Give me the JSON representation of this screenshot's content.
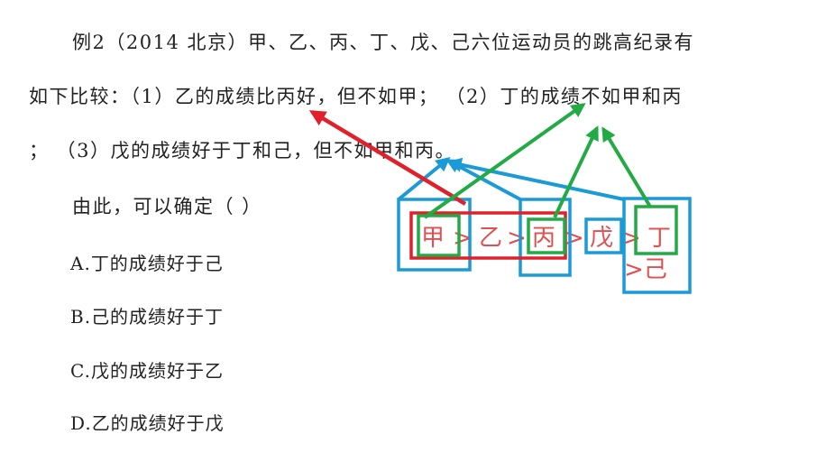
{
  "question": {
    "line1": "例2（2014 北京）甲、乙、丙、丁、戊、己六位运动员的跳高纪录有",
    "line2": "如下比较：（1）乙的成绩比丙好，但不如甲；  （2）丁的成绩不如甲和丙",
    "line3": "；  （3）戊的成绩好于丁和己，但不如甲和丙。",
    "prompt": "由此，可以确定（     ）"
  },
  "options": [
    {
      "label": "A.",
      "text": "丁的成绩好于己"
    },
    {
      "label": "B.",
      "text": "己的成绩好于丁"
    },
    {
      "label": "C.",
      "text": "戊的成绩好于乙"
    },
    {
      "label": "D.",
      "text": "乙的成绩好于戊"
    }
  ],
  "annotation": {
    "chain": [
      "甲",
      ">",
      "乙",
      ">",
      "丙",
      ">",
      "戊",
      ">",
      "丁"
    ],
    "branch": ">己",
    "colors": {
      "red": "#e0202a",
      "green": "#22aa44",
      "blue": "#1a9ad6",
      "text": "#e05050"
    }
  }
}
